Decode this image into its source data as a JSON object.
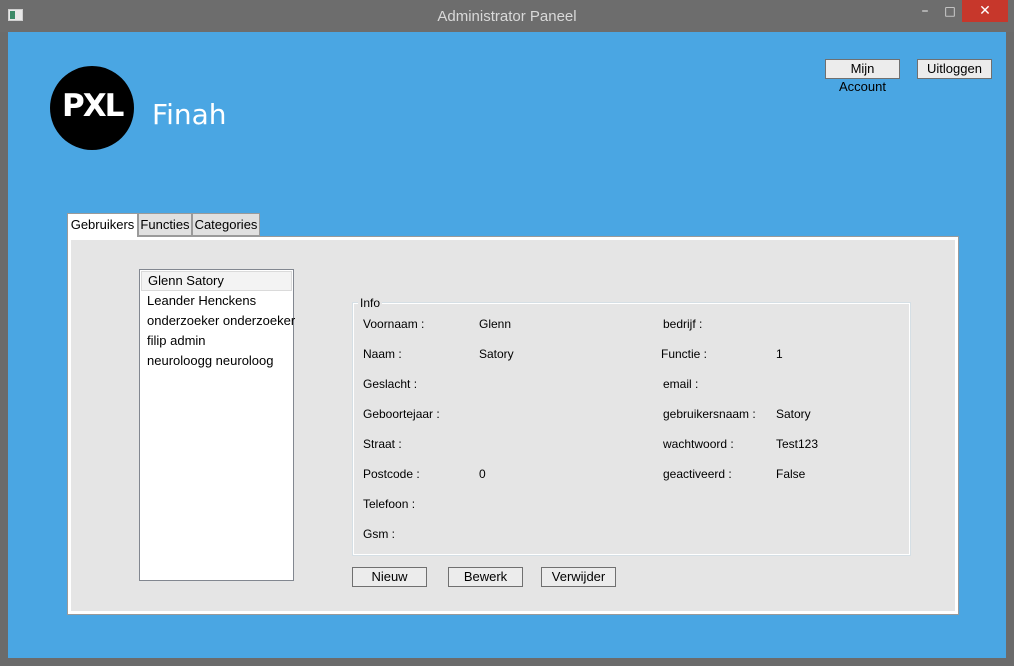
{
  "window": {
    "title": "Administrator Paneel",
    "min_glyph": "–",
    "max_glyph": "□",
    "close_glyph": "✕"
  },
  "header": {
    "logo_text": "PXL",
    "app_name": "Finah",
    "account_button": "Mijn Account",
    "logout_button": "Uitloggen"
  },
  "tabs": [
    {
      "label": "Gebruikers",
      "active": true
    },
    {
      "label": "Functies",
      "active": false
    },
    {
      "label": "Categories",
      "active": false
    }
  ],
  "users": [
    "Glenn Satory",
    "Leander Henckens",
    "onderzoeker onderzoeker",
    "filip admin",
    "neuroloogg neuroloog"
  ],
  "selected_user": "Glenn Satory",
  "info": {
    "legend": "Info",
    "left": [
      {
        "label": "Voornaam :",
        "value": "Glenn"
      },
      {
        "label": "Naam :",
        "value": "Satory"
      },
      {
        "label": "Geslacht :",
        "value": ""
      },
      {
        "label": "Geboortejaar :",
        "value": ""
      },
      {
        "label": "Straat :",
        "value": ""
      },
      {
        "label": "Postcode :",
        "value": "0"
      },
      {
        "label": "Telefoon :",
        "value": ""
      },
      {
        "label": "Gsm :",
        "value": ""
      }
    ],
    "right": [
      {
        "label": "bedrijf :",
        "value": ""
      },
      {
        "label": "Functie :",
        "value": "1"
      },
      {
        "label": "email :",
        "value": ""
      },
      {
        "label": "gebruikersnaam :",
        "value": "Satory"
      },
      {
        "label": "wachtwoord :",
        "value": "Test123"
      },
      {
        "label": "geactiveerd :",
        "value": "False"
      }
    ]
  },
  "actions": {
    "new": "Nieuw",
    "edit": "Bewerk",
    "delete": "Verwijder"
  },
  "colors": {
    "client_background": "#4aa6e3",
    "close_button": "#c7372b",
    "panel_background": "#e5e5e5"
  }
}
